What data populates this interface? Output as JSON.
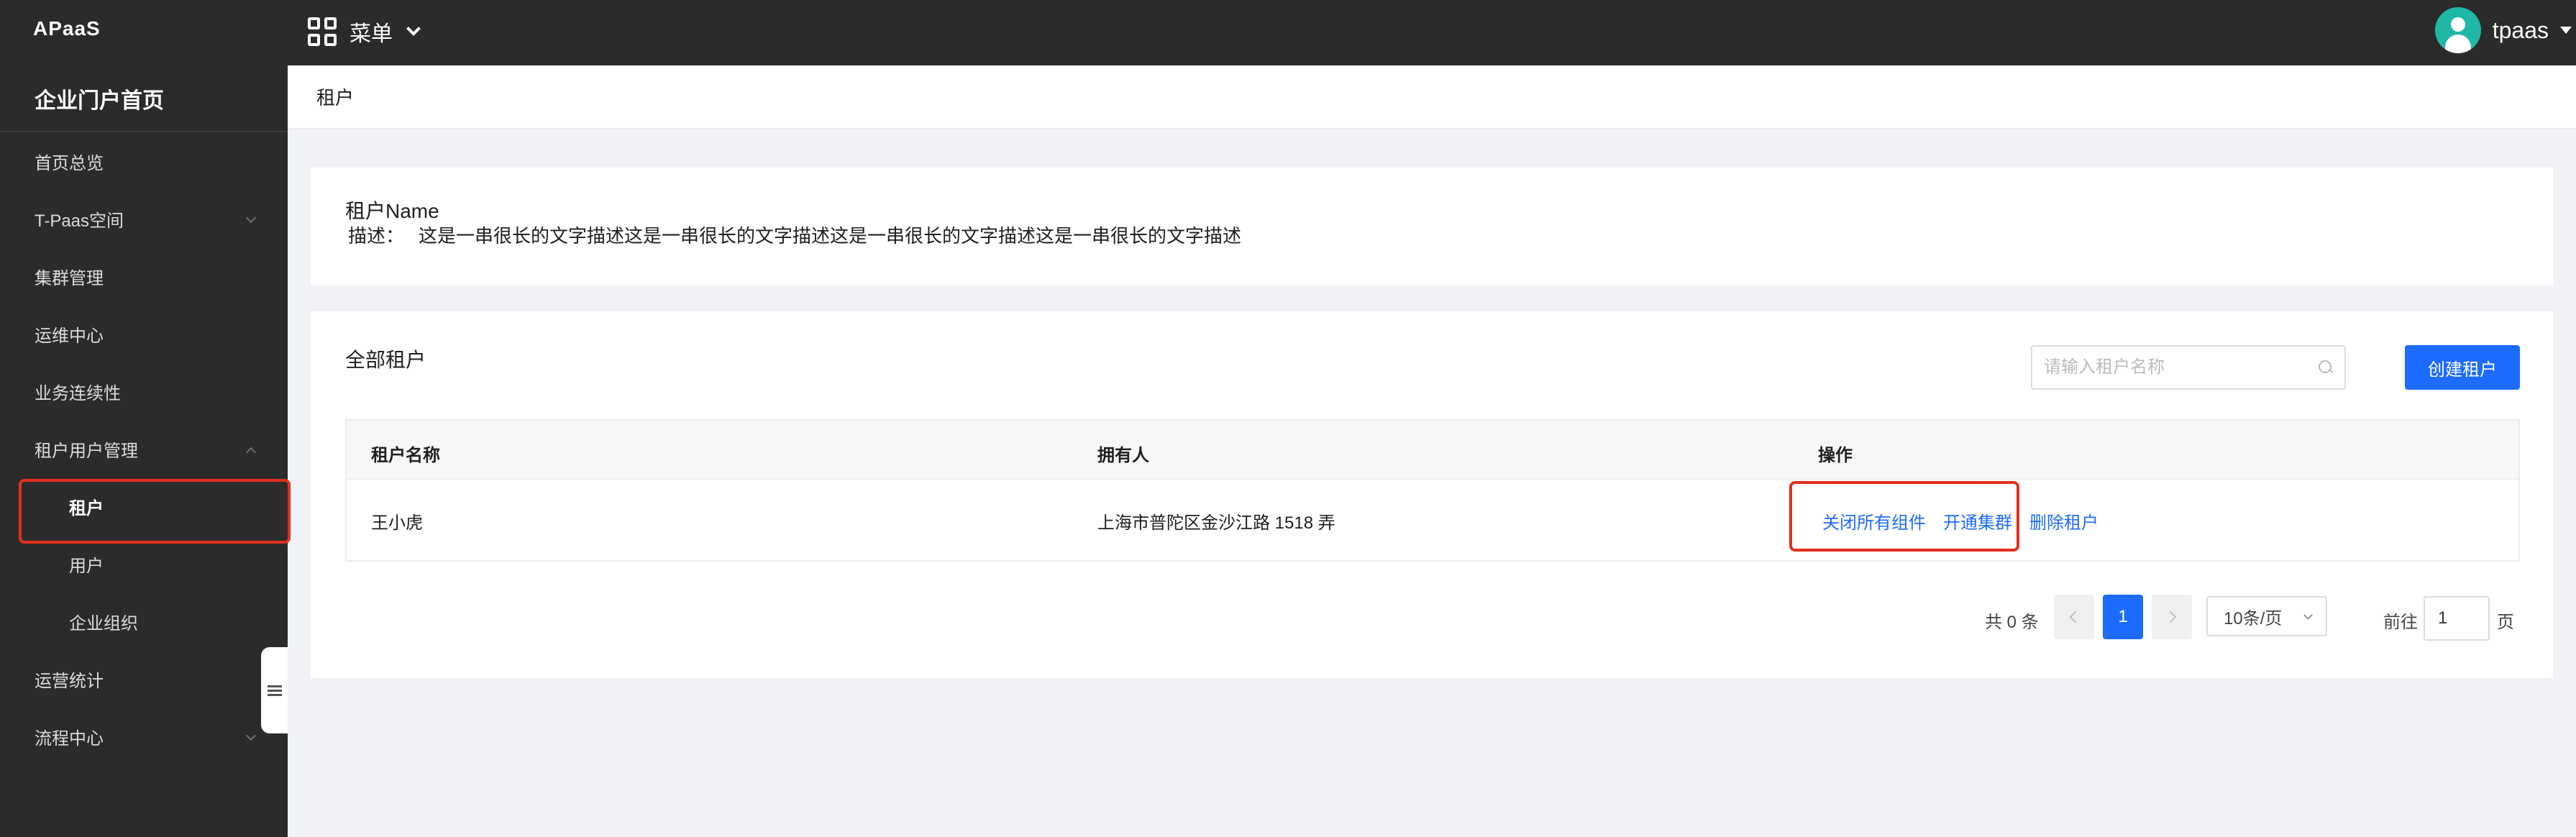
{
  "app": {
    "brand": "APaaS",
    "menu_label": "菜单",
    "user_name": "tpaas"
  },
  "sidebar": {
    "home": "企业门户首页",
    "items": [
      {
        "label": "首页总览",
        "arrow": ""
      },
      {
        "label": "T-Paas空间",
        "arrow": "down"
      },
      {
        "label": "集群管理",
        "arrow": ""
      },
      {
        "label": "运维中心",
        "arrow": ""
      },
      {
        "label": "业务连续性",
        "arrow": ""
      },
      {
        "label": "租户用户管理",
        "arrow": "up"
      },
      {
        "label": "租户",
        "sub": true,
        "active": true
      },
      {
        "label": "用户",
        "sub": true
      },
      {
        "label": "企业组织",
        "sub": true
      },
      {
        "label": "运营统计",
        "arrow": ""
      },
      {
        "label": "流程中心",
        "arrow": "down"
      }
    ]
  },
  "header": {
    "title": "租户"
  },
  "info": {
    "name": "租户Name",
    "desc_label": "描述：",
    "desc_text": "这是一串很长的文字描述这是一串很长的文字描述这是一串很长的文字描述这是一串很长的文字描述"
  },
  "list": {
    "title": "全部租户",
    "search_placeholder": "请输入租户名称",
    "create_label": "创建租户",
    "columns": [
      "租户名称",
      "拥有人",
      "操作"
    ],
    "rows": [
      {
        "name": "王小虎",
        "owner": "上海市普陀区金沙江路 1518 弄",
        "actions": [
          "关闭所有组件",
          "开通集群",
          "删除租户"
        ]
      }
    ]
  },
  "pagination": {
    "total_text": "共 0 条",
    "current_page": "1",
    "page_size": "10条/页",
    "goto_label": "前往",
    "goto_value": "1",
    "page_suffix": "页"
  },
  "colors": {
    "accent": "#1e6bff",
    "highlight": "#e1301d",
    "sidebar_bg": "#2b2b2b",
    "avatar": "#1fb8a6"
  }
}
